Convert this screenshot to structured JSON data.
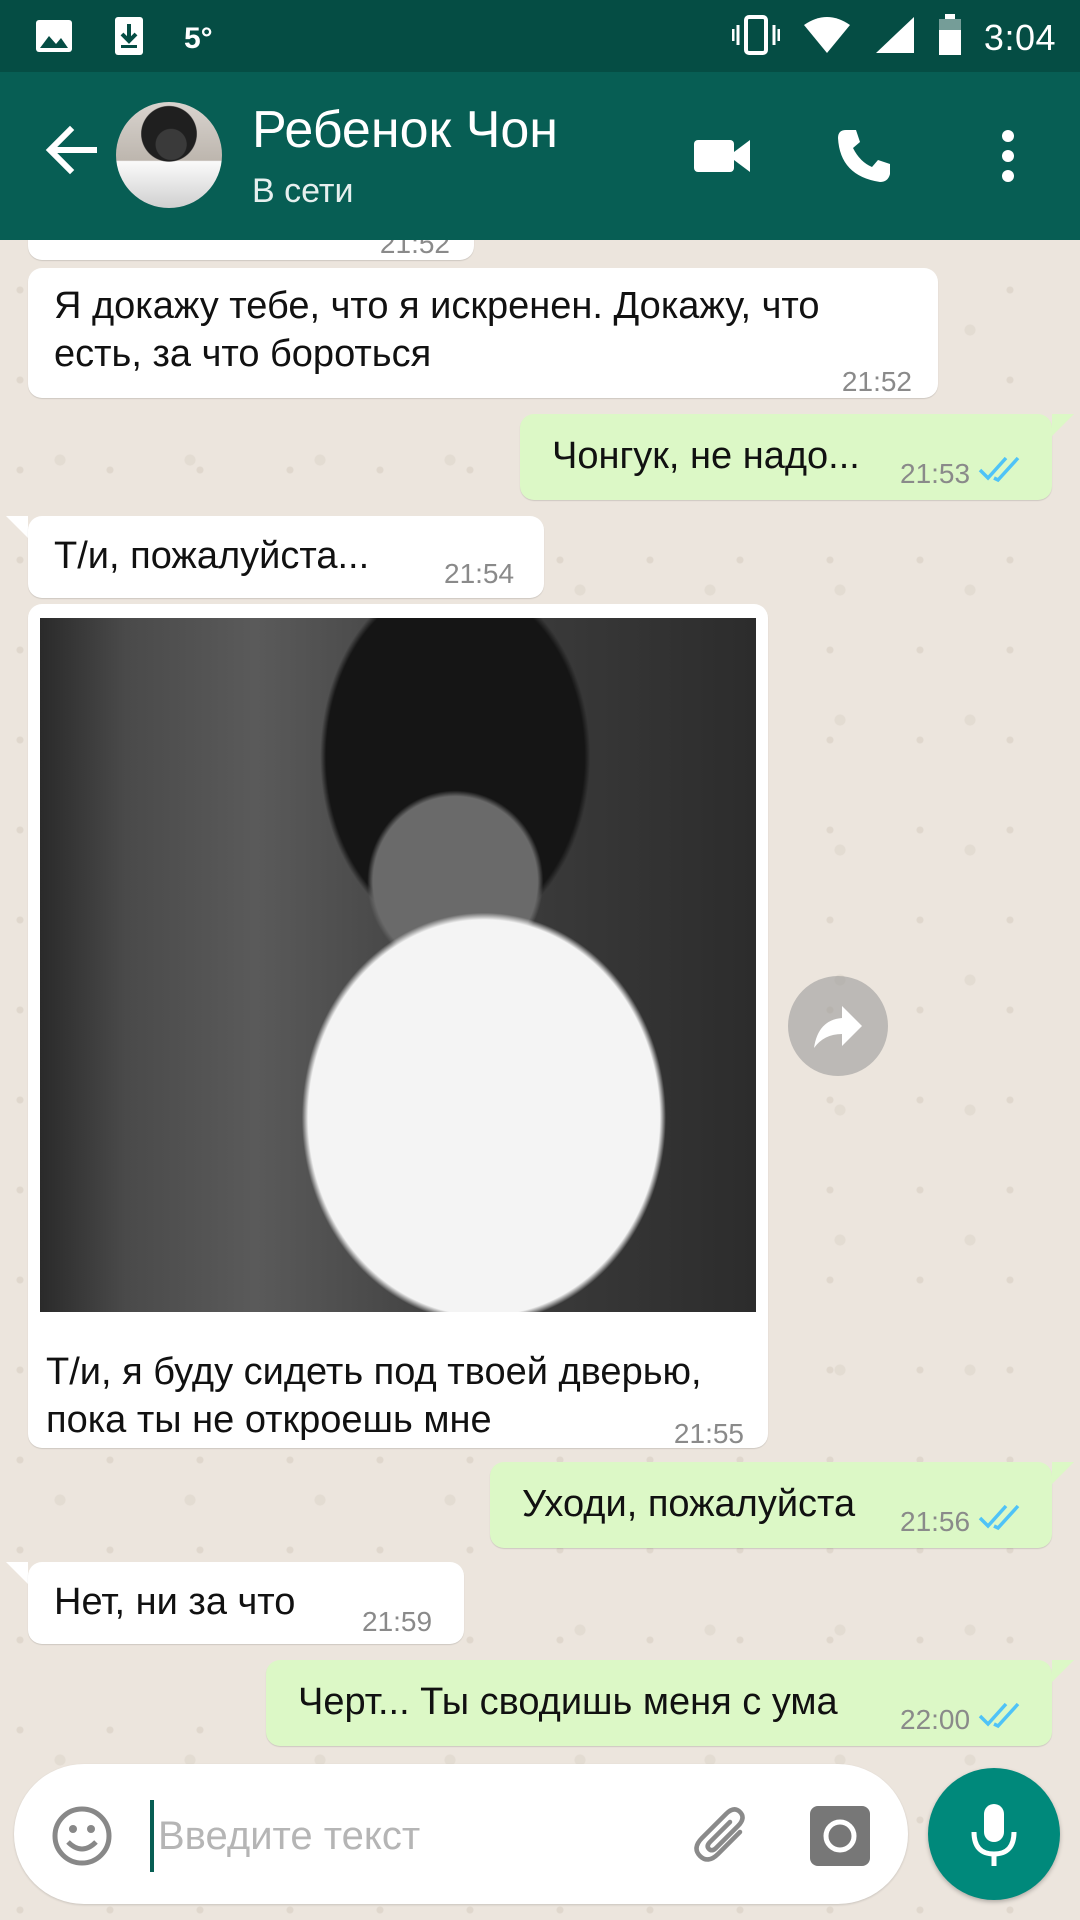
{
  "status_bar": {
    "temperature": "5°",
    "time": "3:04",
    "icons": [
      "image-icon",
      "download-icon",
      "vibrate-icon",
      "wifi-icon",
      "signal-icon",
      "battery-icon"
    ]
  },
  "header": {
    "contact_name": "Ребенок Чон",
    "contact_status": "В сети",
    "icons": [
      "back-arrow-icon",
      "video-call-icon",
      "phone-icon",
      "more-vert-icon"
    ]
  },
  "messages": [
    {
      "id": "m0",
      "direction": "in",
      "text": "",
      "time": "21:52",
      "partial": true
    },
    {
      "id": "m1",
      "direction": "in",
      "text_line1": "Я докажу тебе, что я искренен. Докажу, что",
      "text_line2": "есть, за что бороться",
      "time": "21:52"
    },
    {
      "id": "m2",
      "direction": "out",
      "text": "Чонгук, не надо...",
      "time": "21:53",
      "status": "read"
    },
    {
      "id": "m3",
      "direction": "in",
      "text": "Т/и, пожалуйста...",
      "time": "21:54"
    },
    {
      "id": "m4",
      "direction": "in",
      "type": "image",
      "caption_line1": "Т/и, я буду сидеть под твоей дверью,",
      "caption_line2": "пока ты не откроешь мне",
      "time": "21:55"
    },
    {
      "id": "m5",
      "direction": "out",
      "text": "Уходи, пожалуйста",
      "time": "21:56",
      "status": "read"
    },
    {
      "id": "m6",
      "direction": "in",
      "text": "Нет, ни за что",
      "time": "21:59"
    },
    {
      "id": "m7",
      "direction": "out",
      "text": "Черт... Ты сводишь меня с ума",
      "time": "22:00",
      "status": "read"
    }
  ],
  "input": {
    "placeholder": "Введите текст",
    "value": ""
  },
  "colors": {
    "header": "#075e54",
    "status_bar": "#054d44",
    "outgoing_bubble": "#dcf8c6",
    "incoming_bubble": "#ffffff",
    "read_ticks": "#4fc3f7",
    "mic_button": "#00897b"
  }
}
